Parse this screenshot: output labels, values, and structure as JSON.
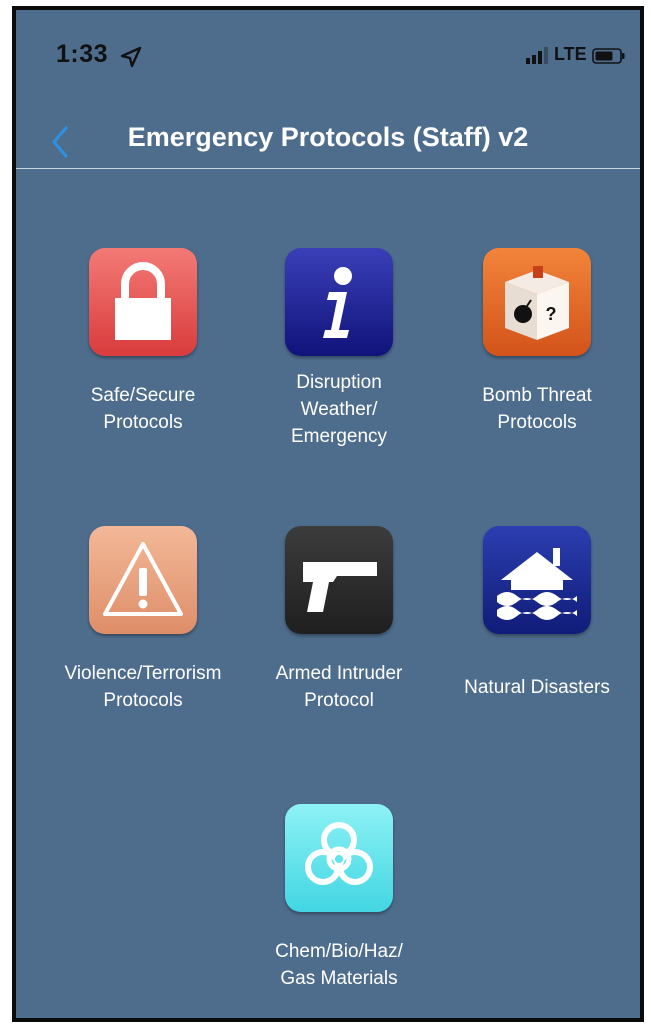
{
  "status_bar": {
    "time": "1:33",
    "network": "LTE",
    "icons": [
      "location-arrow-icon",
      "signal-bars-icon",
      "battery-icon"
    ]
  },
  "nav": {
    "back_icon": "chevron-left-icon",
    "title": "Emergency Protocols (Staff) v2"
  },
  "colors": {
    "background": "#4e6d8d",
    "safe_secure": "#e24a4a",
    "disruption": "#1a1f8f",
    "bomb_threat": "#e2651f",
    "violence": "#e9a07c",
    "armed_intruder": "#2e2e2e",
    "natural_disasters": "#1b2a8c",
    "chem_bio": "#5fe3ec"
  },
  "tiles": [
    {
      "label_lines": [
        "Safe/Secure",
        "Protocols"
      ],
      "icon": "padlock-icon"
    },
    {
      "label_lines": [
        "Disruption",
        "Weather/",
        "Emergency"
      ],
      "icon": "info-icon"
    },
    {
      "label_lines": [
        "Bomb Threat",
        "Protocols"
      ],
      "icon": "bomb-box-icon"
    },
    {
      "label_lines": [
        "Violence/Terrorism",
        "Protocols"
      ],
      "icon": "warning-triangle-icon"
    },
    {
      "label_lines": [
        "Armed Intruder",
        "Protocol"
      ],
      "icon": "pistol-icon"
    },
    {
      "label_lines": [
        "Natural Disasters"
      ],
      "icon": "flooded-house-icon"
    },
    {
      "label_lines": [
        "Chem/Bio/Haz/",
        "Gas Materials"
      ],
      "icon": "biohazard-icon"
    }
  ]
}
